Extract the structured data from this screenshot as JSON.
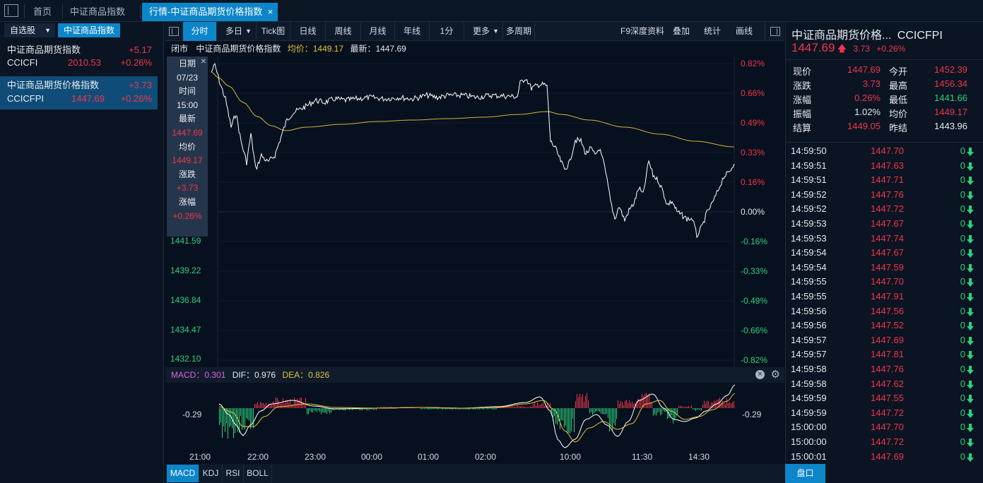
{
  "tabs": {
    "home": "首页",
    "tab1": "中证商品指数",
    "tab2": "行情-中证商品期货价格指数",
    "close": "×"
  },
  "left": {
    "watchlist_btn": "自选股",
    "category_btn": "中证商品指数",
    "items": [
      {
        "name": "中证商品期货指数",
        "code": "CCICFI",
        "price": "2010.53",
        "change": "+5.17",
        "pct": "+0.26%"
      },
      {
        "name": "中证商品期货价格指数",
        "code": "CCICFPI",
        "price": "1447.69",
        "change": "+3.73",
        "pct": "+0.26%"
      }
    ]
  },
  "toolbar": {
    "items": [
      "分时",
      "多日",
      "Tick图",
      "日线",
      "周线",
      "月线",
      "年线",
      "1分",
      "更多",
      "多周期"
    ],
    "right": [
      "F9深度资料",
      "叠加",
      "统计",
      "画线"
    ]
  },
  "infobar": {
    "status": "闭市",
    "name": "中证商品期货价格指数",
    "avg_label": "均价：1449.17",
    "latest_label": "最新：1447.69"
  },
  "tooltip": {
    "close": "×",
    "rows": [
      "日期",
      "07/23",
      "时间",
      "15:00",
      "最新",
      "1447.69",
      "均价",
      "1449.17",
      "涨跌",
      "+3.73",
      "涨幅",
      "+0.26%"
    ]
  },
  "chart_data": {
    "type": "line",
    "series": [
      {
        "name": "最新",
        "color": "#ffffff"
      },
      {
        "name": "均价",
        "color": "#e6c23a"
      }
    ],
    "y_left_ticks": [
      "1441.59",
      "1439.22",
      "1436.84",
      "1434.47",
      "1432.10"
    ],
    "y_right_ticks": [
      "0.82%",
      "0.66%",
      "0.49%",
      "0.33%",
      "0.16%",
      "0.00%",
      "-0.16%",
      "-0.33%",
      "-0.49%",
      "-0.66%",
      "-0.82%"
    ],
    "x_ticks": [
      "21:00",
      "22:00",
      "23:00",
      "00:00",
      "01:00",
      "02:00",
      "10:00",
      "11:30",
      "14:30"
    ],
    "pre_settle": 1443.96,
    "ylim": [
      1432.1,
      1455.82
    ]
  },
  "macd": {
    "macd_label": "MACD：0.301",
    "dif_label": "DIF：0.976",
    "dea_label": "DEA：0.826",
    "axis_left": "-0.29",
    "axis_right": "-0.29"
  },
  "bottom": {
    "items": [
      "MACD",
      "KDJ",
      "RSI",
      "BOLL"
    ]
  },
  "quote": {
    "title": "中证商品期货价格...",
    "code": "CCICFPI",
    "price": "1447.69",
    "change": "3.73",
    "pct": "+0.26%",
    "rows": [
      {
        "l1": "现价",
        "v1": "1447.69",
        "c1": "red",
        "l2": "今开",
        "v2": "1452.39",
        "c2": "red"
      },
      {
        "l1": "涨跌",
        "v1": "3.73",
        "c1": "red",
        "l2": "最高",
        "v2": "1456.34",
        "c2": "red"
      },
      {
        "l1": "涨幅",
        "v1": "0.26%",
        "c1": "red",
        "l2": "最低",
        "v2": "1441.66",
        "c2": "green"
      },
      {
        "l1": "振幅",
        "v1": "1.02%",
        "c1": "white",
        "l2": "均价",
        "v2": "1449.17",
        "c2": "red"
      },
      {
        "l1": "结算",
        "v1": "1449.05",
        "c1": "red",
        "l2": "昨结",
        "v2": "1443.96",
        "c2": "white"
      }
    ]
  },
  "ticks": [
    {
      "t": "14:59:50",
      "p": "1447.70",
      "v": "0"
    },
    {
      "t": "14:59:51",
      "p": "1447.63",
      "v": "0"
    },
    {
      "t": "14:59:51",
      "p": "1447.71",
      "v": "0"
    },
    {
      "t": "14:59:52",
      "p": "1447.76",
      "v": "0"
    },
    {
      "t": "14:59:52",
      "p": "1447.72",
      "v": "0"
    },
    {
      "t": "14:59:53",
      "p": "1447.67",
      "v": "0"
    },
    {
      "t": "14:59:53",
      "p": "1447.74",
      "v": "0"
    },
    {
      "t": "14:59:54",
      "p": "1447.67",
      "v": "0"
    },
    {
      "t": "14:59:54",
      "p": "1447.59",
      "v": "0"
    },
    {
      "t": "14:59:55",
      "p": "1447.70",
      "v": "0"
    },
    {
      "t": "14:59:55",
      "p": "1447.91",
      "v": "0"
    },
    {
      "t": "14:59:56",
      "p": "1447.56",
      "v": "0"
    },
    {
      "t": "14:59:56",
      "p": "1447.52",
      "v": "0"
    },
    {
      "t": "14:59:57",
      "p": "1447.69",
      "v": "0"
    },
    {
      "t": "14:59:57",
      "p": "1447.81",
      "v": "0"
    },
    {
      "t": "14:59:58",
      "p": "1447.76",
      "v": "0"
    },
    {
      "t": "14:59:58",
      "p": "1447.62",
      "v": "0"
    },
    {
      "t": "14:59:59",
      "p": "1447.55",
      "v": "0"
    },
    {
      "t": "14:59:59",
      "p": "1447.72",
      "v": "0"
    },
    {
      "t": "15:00:00",
      "p": "1447.70",
      "v": "0"
    },
    {
      "t": "15:00:00",
      "p": "1447.72",
      "v": "0"
    },
    {
      "t": "15:00:01",
      "p": "1447.69",
      "v": "0"
    }
  ],
  "pankou": "盘口"
}
